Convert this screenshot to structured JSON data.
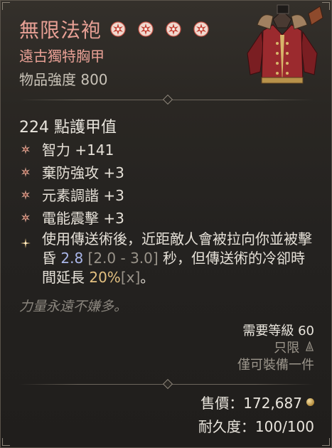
{
  "item": {
    "name": "無限法袍",
    "stars": 4,
    "type": "遠古獨特胸甲",
    "power": "物品強度 800",
    "armor": "224 點護甲值",
    "icon": "chest-armor-icon"
  },
  "affixes": [
    {
      "text": "智力 +141"
    },
    {
      "text": "棄防強攻 +3"
    },
    {
      "text": "元素調諧 +3"
    },
    {
      "text": "電能震擊 +3"
    }
  ],
  "legendary": {
    "part1": "使用傳送術後，近距敵人會被拉向你並被擊昏 ",
    "value": "2.8",
    "range": " [2.0 - 3.0] ",
    "part2": "秒，但傳送術的冷卻時間延長 ",
    "percent": "20%",
    "suffix": "[x]",
    "end": "。"
  },
  "flavor": "力量永遠不嫌多。",
  "requirements": {
    "level": "需要等級 60",
    "bound": "只限",
    "equip_limit": "僅可裝備一件"
  },
  "footer": {
    "price": "售價：172,687",
    "durability": "耐久度：100/100"
  },
  "colors": {
    "title": "#e8a095",
    "value_blue": "#aab6e8",
    "highlight": "#e3c080"
  }
}
